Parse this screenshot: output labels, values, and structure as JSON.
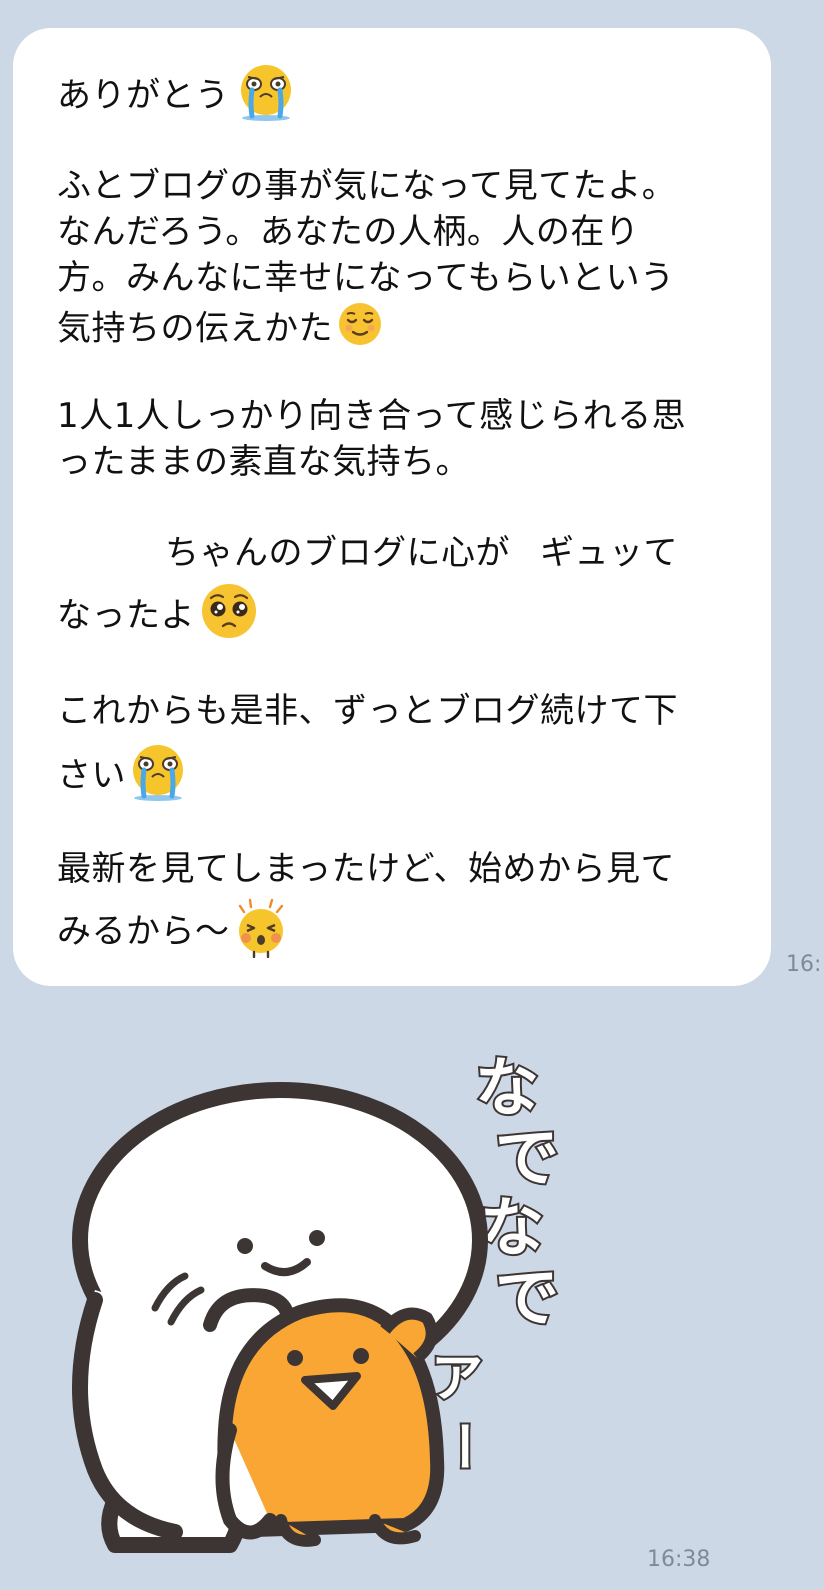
{
  "message": {
    "lines": [
      "ありがとう",
      "ふとブログの事が気になって見てたよ。",
      "なんだろう。あなたの人柄。人の在り",
      "方。みんなに幸せになってもらいという",
      "気持ちの伝えかた",
      "1人1人しっかり向き合って感じられる思",
      "ったままの素直な気持ち。",
      "ちゃんのブログに心が",
      "ギュッて",
      "なったよ",
      "これからも是非、ずっとブログ続けて下",
      "さい",
      "最新を見てしまったけど、始めから見て",
      "みるから～"
    ],
    "time": "16:"
  },
  "sticker": {
    "text": [
      "な",
      "で",
      "な",
      "で",
      "ア",
      "ー"
    ],
    "time": "16:38"
  },
  "colors": {
    "background": "#cdd8e6",
    "bubble": "#ffffff",
    "time": "#7f8a99",
    "sticker_orange": "#f9a634",
    "sticker_outline": "#3d3533"
  },
  "icons": [
    "crying-face-icon",
    "relieved-face-icon",
    "pleading-face-icon",
    "crying-face-icon",
    "excited-face-icon"
  ]
}
